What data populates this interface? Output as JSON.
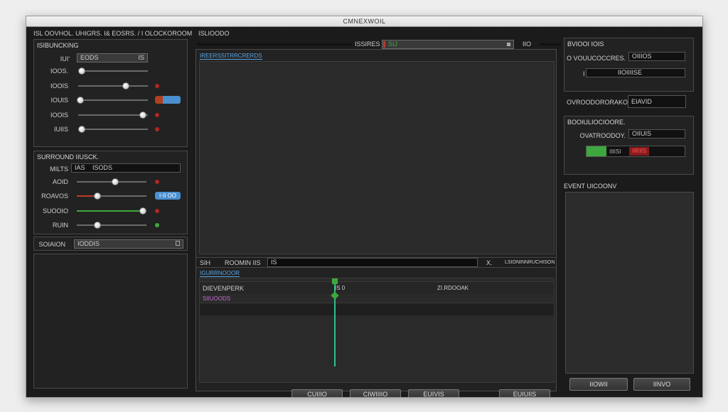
{
  "window": {
    "title": "CMNEXWOIL"
  },
  "menubar": {
    "left_text": "ISL OOVHOL. UHIGRS. I& EOSRS. / I OLOCKOROOM",
    "right_text": "ISLIOODO"
  },
  "left_panel": {
    "title": "ISIBUNCKING",
    "name_label": "IUI'",
    "name_value": "EODS",
    "name_suffix": "IS",
    "sliders": [
      {
        "label": "IOOS.",
        "value": 0.05,
        "dot": ""
      },
      {
        "label": "IOOIS",
        "value": 0.68,
        "dot": "#b0281f"
      },
      {
        "label": "IOUIS",
        "value": 0.03,
        "dot": "",
        "chip": "blue"
      },
      {
        "label": "IOOIS",
        "value": 0.93,
        "dot": "#b0281f"
      },
      {
        "label": "IUIIS",
        "value": 0.05,
        "dot": "#b0281f"
      }
    ]
  },
  "left_panel2": {
    "title": "SURROUND IIUSCK.",
    "field_label": "MILTS",
    "field_prefix": "IAS",
    "field_value": "ISODS",
    "sliders": [
      {
        "label": "AOID",
        "value": 0.55,
        "dot": "#b0281f",
        "fill": ""
      },
      {
        "label": "ROAVOS",
        "value": 0.3,
        "dot": "",
        "fill": "#c0392b",
        "chip_text": "I·II OO"
      },
      {
        "label": "SUOOIO",
        "value": 0.95,
        "dot": "#b0281f",
        "fill": "#3ea83e"
      },
      {
        "label": "RUIN",
        "value": 0.3,
        "dot": "#3ea83e",
        "fill": ""
      }
    ]
  },
  "source": {
    "label": "SOIAION",
    "value": "IODDIS"
  },
  "top_center": {
    "status_label": "ISSIRES",
    "status_badge": "SIJ",
    "right_text": "IIO"
  },
  "preview": {
    "tab": "IREERSSITRRCRERDS"
  },
  "timeline_bar": {
    "label_left": "SIH",
    "label_mid": "ROOMIN IIS",
    "field_prefix": "IS",
    "x_label": "X.",
    "right_text": "LSIONINNRUCHISON"
  },
  "timeline": {
    "tab": "IGURRNOOOR",
    "rows": [
      {
        "label": "DIEVENPERK",
        "marker": "IS 0",
        "right": "ZI.RDOOAK"
      },
      {
        "label": "SIIUOODS",
        "marker": "",
        "right": ""
      }
    ],
    "playhead_color": "#2fbf8f"
  },
  "bottom_buttons": [
    "CUIIIO",
    "CIWIIIIO",
    "EUIVIS",
    "EUIUIIS"
  ],
  "right_panel1": {
    "title": "BVIOOI IOIS",
    "field1_label": "O VOUUCOCCRES.",
    "field1_value": "OIIIOS",
    "field2_prefix": "I",
    "field2_value": "IIOIIIISE"
  },
  "right_row": {
    "label": "OVROODORORAKO",
    "value": "EIAVID"
  },
  "right_panel2": {
    "title": "BOOIULIOCIOORE.",
    "field1_label": "OVATROODOY.",
    "field1_value": "OIIUIS",
    "bar_green": "IIIISI",
    "bar_red": "IIRIIS"
  },
  "right_panel3": {
    "title": "EVENT UICOONV"
  },
  "right_buttons": [
    "IIOWII",
    "IINVO"
  ],
  "colors": {
    "accent_blue": "#5aa7e6",
    "red_dot": "#b0281f",
    "green": "#3ea83e",
    "playhead": "#2fbf8f"
  }
}
